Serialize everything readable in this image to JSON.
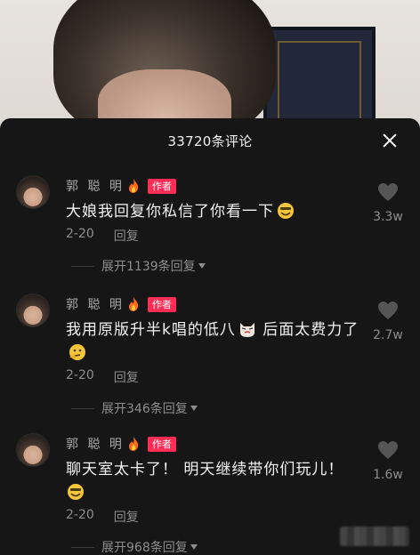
{
  "panel": {
    "title": "33720条评论"
  },
  "colors": {
    "panel_bg": "#161616",
    "badge": "#ff2c55",
    "secondary_text": "#8d8d8d"
  },
  "comments": [
    {
      "author": "郭 聪 明",
      "badge": "作者",
      "text": "大娘我回复你私信了你看一下",
      "emoji": "grinning-face-icon",
      "date": "2-20",
      "reply_label": "回复",
      "likes": "3.3w",
      "expand_label": "展开1139条回复"
    },
    {
      "author": "郭 聪 明",
      "badge": "作者",
      "text": "我用原版升半k唱的低八",
      "text_after_emoji": " 后面太费力了",
      "emoji": "cat-face-icon",
      "emoji_end": "thinking-face-icon",
      "date": "2-20",
      "reply_label": "回复",
      "likes": "2.7w",
      "expand_label": "展开346条回复"
    },
    {
      "author": "郭 聪 明",
      "badge": "作者",
      "text": "聊天室太卡了！ 明天继续带你们玩儿！",
      "emoji": "grinning-face-icon",
      "date": "2-20",
      "reply_label": "回复",
      "likes": "1.6w",
      "expand_label": "展开968条回复"
    }
  ]
}
